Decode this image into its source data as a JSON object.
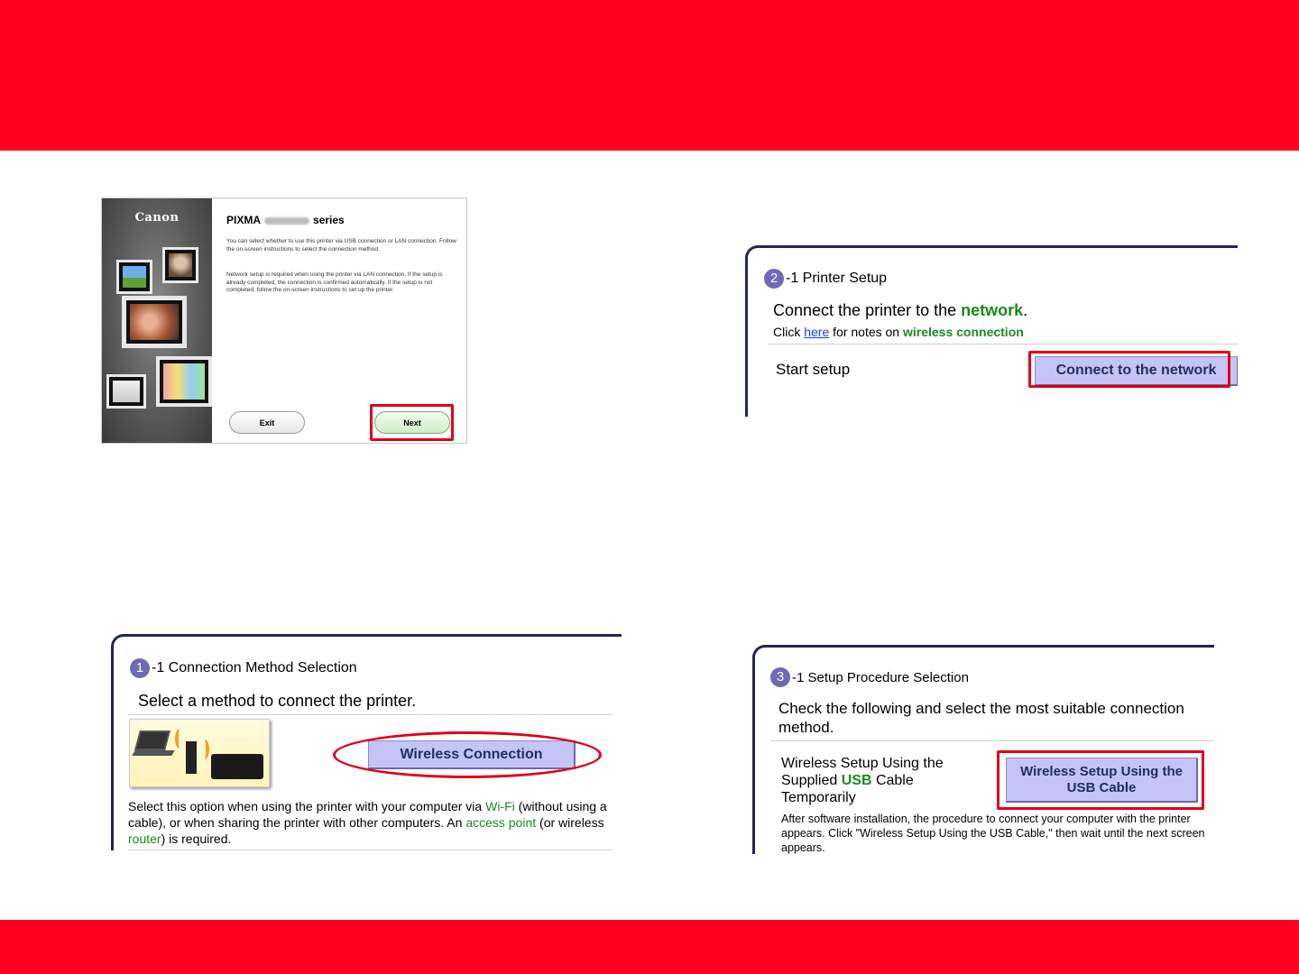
{
  "colors": {
    "brand_red": "#ff0021",
    "highlight_red": "#e0001a",
    "step_purple": "#6e6ab4",
    "button_blue": "#c4c4f6",
    "keyword_green": "#1b8a1b"
  },
  "installer": {
    "logo": "Canon",
    "title_prefix": "PIXMA",
    "title_suffix": "series",
    "para1": "You can select whether to use this printer via USB connection or LAN connection. Follow the on-screen instructions to select the connection method.",
    "para2": "Network setup is required when using the printer via LAN connection. If the setup is already completed, the connection is confirmed automatically. If the setup is not completed, follow the on-screen instructions to set up the printer.",
    "exit_label": "Exit",
    "next_label": "Next"
  },
  "printer_setup": {
    "step_number": "2",
    "step_title": "-1 Printer Setup",
    "heading_pre": "Connect the printer to the ",
    "heading_keyword": "network",
    "heading_post": ".",
    "note_pre": "Click ",
    "note_link": "here",
    "note_mid": " for notes on ",
    "note_keyword": "wireless connection",
    "start_label": "Start setup",
    "button_label": "Connect to the network"
  },
  "connection_method": {
    "step_number": "1",
    "step_title": "-1 Connection Method Selection",
    "heading": "Select a method to connect the printer.",
    "button_label": "Wireless Connection",
    "desc_1": "Select this option when using the printer with your computer via ",
    "desc_wifi": "Wi-Fi",
    "desc_2": " (without using a cable), or when sharing the printer with other computers. An ",
    "desc_ap": "access point",
    "desc_3": " (or wireless ",
    "desc_router": "router",
    "desc_4": ") is required."
  },
  "setup_procedure": {
    "step_number": "3",
    "step_title": "-1 Setup Procedure Selection",
    "heading": "Check the following and select the most suitable connection method.",
    "option_1": "Wireless Setup Using the",
    "option_2": "Supplied ",
    "option_usb": "USB",
    "option_3": " Cable",
    "option_4": "Temporarily",
    "button_line1": "Wireless Setup Using the",
    "button_line2": "USB Cable",
    "note": "After software installation, the procedure to connect your computer with the printer appears. Click \"Wireless Setup Using the USB Cable,\" then wait until the next screen appears."
  }
}
